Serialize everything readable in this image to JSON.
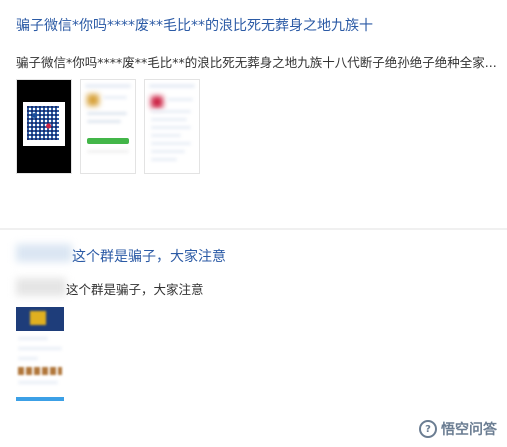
{
  "posts": [
    {
      "title": "骗子微信*你吗****废**毛比**的浪比死无葬身之地九族十",
      "excerpt": "骗子微信*你吗****废**毛比**的浪比死无葬身之地九族十八代断子绝孙绝子绝种全家..."
    },
    {
      "title": "这个群是骗子，大家注意",
      "excerpt": "这个群是骗子，大家注意"
    }
  ],
  "watermark": {
    "text": "悟空问答",
    "icon": "speech-bubble-icon"
  }
}
